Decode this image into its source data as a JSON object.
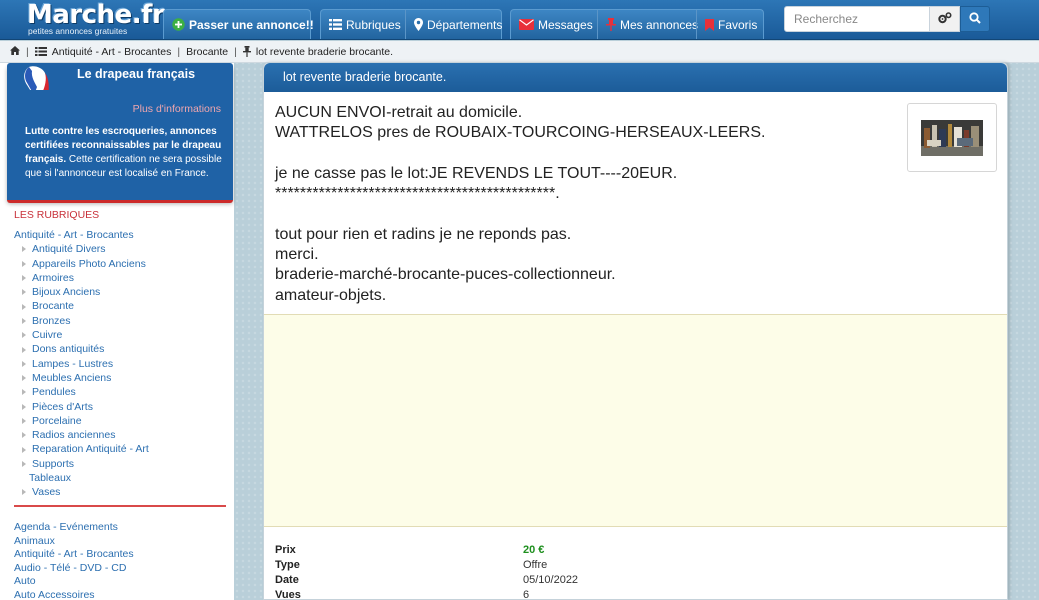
{
  "header": {
    "logo_name": "Marche.fr",
    "logo_tagline": "petites annonces gratuites",
    "post_ad_label": "Passer une annonce!!",
    "rubriques_label": "Rubriques",
    "departements_label": "Départements",
    "messages_label": "Messages",
    "mes_annonces_label": "Mes annonces",
    "favoris_label": "Favoris",
    "search_placeholder": "Recherchez",
    "accent_color": "#1f62a6"
  },
  "breadcrumb": {
    "items": [
      "Antiquité - Art - Brocantes",
      "Brocante",
      "lot revente braderie brocante."
    ]
  },
  "sidebar": {
    "flag_title": "Le drapeau français",
    "flag_more": "Plus d'informations",
    "flag_text_bold": "Lutte contre les escroqueries, annonces certifiées reconnaissables par le drapeau français.",
    "flag_text_rest": " Cette certification ne sera possible que si l'annonceur est localisé en France.",
    "rubriques_title": "LES RUBRIQUES",
    "current_category": "Antiquité - Art - Brocantes",
    "subcategories": [
      "Antiquité Divers",
      "Appareils Photo Anciens",
      "Armoires",
      "Bijoux Anciens",
      "Brocante",
      "Bronzes",
      "Cuivre",
      "Dons antiquités",
      "Lampes - Lustres",
      "Meubles Anciens",
      "Pendules",
      "Pièces d'Arts",
      "Porcelaine",
      "Radios anciennes",
      "Reparation Antiquité - Art",
      "Supports",
      "Tableaux",
      "Vases"
    ],
    "main_categories": [
      "Agenda - Evénements",
      "Animaux",
      "Antiquité - Art - Brocantes",
      "Audio - Télé - DVD - CD",
      "Auto",
      "Auto Accessoires"
    ]
  },
  "listing": {
    "title": "lot revente braderie brocante.",
    "description_lines": [
      "AUCUN ENVOI-retrait au domicile.",
      "WATTRELOS pres de ROUBAIX-TOURCOING-HERSEAUX-LEERS.",
      "",
      "je ne casse pas le lot:JE REVENDS LE TOUT----20EUR.",
      "*********************************************.",
      "",
      "tout pour rien et radins je ne reponds pas.",
      "merci.",
      "braderie-marché-brocante-puces-collectionneur.",
      "amateur-objets."
    ],
    "details": [
      {
        "label": "Prix",
        "value": "20 €"
      },
      {
        "label": "Type",
        "value": "Offre"
      },
      {
        "label": "Date",
        "value": "05/10/2022"
      },
      {
        "label": "Vues",
        "value": "6"
      }
    ],
    "price_color": "#1e8f1e"
  }
}
